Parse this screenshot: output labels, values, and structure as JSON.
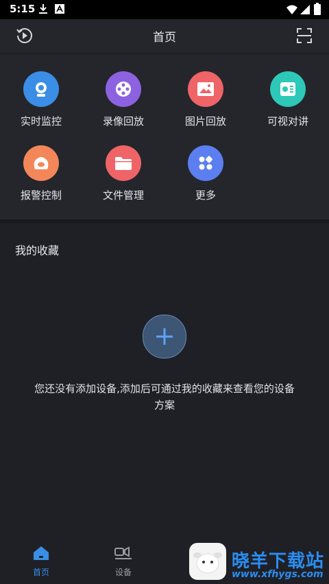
{
  "status_bar": {
    "time": "5:15"
  },
  "header": {
    "title": "首页"
  },
  "functions": [
    {
      "label": "实时监控",
      "icon": "camera-icon",
      "color": "#3a8ee6"
    },
    {
      "label": "录像回放",
      "icon": "film-reel-icon",
      "color": "#8d62e0"
    },
    {
      "label": "图片回放",
      "icon": "image-icon",
      "color": "#ef6467"
    },
    {
      "label": "可视对讲",
      "icon": "intercom-icon",
      "color": "#2ec8b8"
    },
    {
      "label": "报警控制",
      "icon": "alarm-icon",
      "color": "#f3875a"
    },
    {
      "label": "文件管理",
      "icon": "folder-icon",
      "color": "#ef6467"
    },
    {
      "label": "更多",
      "icon": "apps-grid-icon",
      "color": "#5b7ff0"
    }
  ],
  "favorites": {
    "title": "我的收藏",
    "empty_line1": "您还没有添加设备,添加后可通过我的收藏来查看您的设备",
    "empty_line2": "方案"
  },
  "tabs": [
    {
      "label": "首页",
      "icon": "home-icon",
      "active": true
    },
    {
      "label": "设备",
      "icon": "device-icon",
      "active": false
    }
  ],
  "watermark": {
    "title": "晓羊下载站",
    "url": "www.xfhygs.com"
  },
  "colors": {
    "background": "#1f2026",
    "panel": "#24262c",
    "accent": "#3a8ee6"
  }
}
